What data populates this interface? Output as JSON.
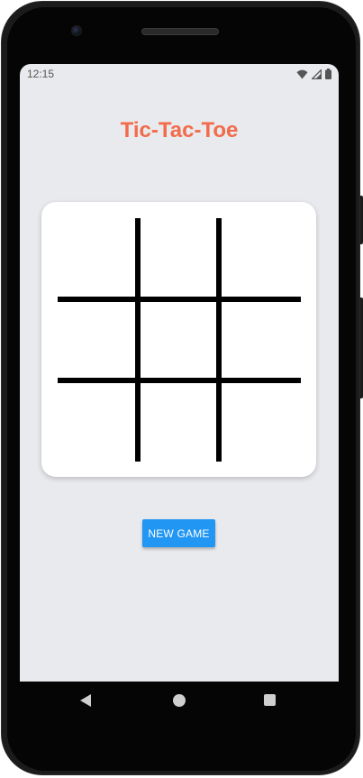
{
  "status_bar": {
    "time": "12:15",
    "icons": [
      "wifi-icon",
      "cellular-signal-icon",
      "battery-icon"
    ]
  },
  "app": {
    "title": "Tic-Tac-Toe"
  },
  "board": {
    "cells": [
      "",
      "",
      "",
      "",
      "",
      "",
      "",
      "",
      ""
    ]
  },
  "controls": {
    "new_game_label": "NEW GAME"
  },
  "nav_bar": {
    "items": [
      "back-icon",
      "home-icon",
      "recents-icon"
    ]
  },
  "colors": {
    "title": "#f26b4d",
    "button": "#2196f3",
    "screen_background": "#e9eaed",
    "board_background": "#ffffff",
    "grid_lines": "#000000"
  }
}
